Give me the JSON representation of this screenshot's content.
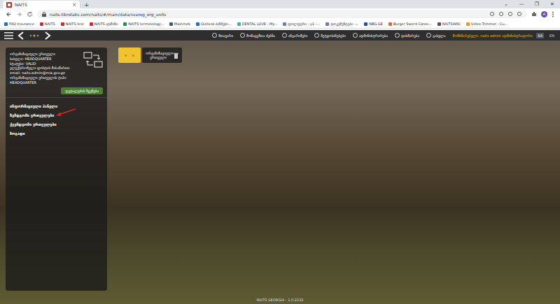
{
  "browser": {
    "tab_title": "NAITS",
    "tab_close": "×",
    "new_tab": "+",
    "window_controls": [
      "⌄",
      "—",
      "❐",
      "✕"
    ],
    "url": "naits.tibrolabs.com/naits/#/main/data/svarog_org_units",
    "profile": "A"
  },
  "bookmarks": [
    {
      "label": "FAO Insurance",
      "color": "#2b6cb0"
    },
    {
      "label": "NAITS",
      "color": "#c53030"
    },
    {
      "label": "NAITS test",
      "color": "#c53030"
    },
    {
      "label": "NAITS ადმინი",
      "color": "#c53030"
    },
    {
      "label": "NAITS terminology...",
      "color": "#2f855a"
    },
    {
      "label": "Mainmeb",
      "color": "#4a5568"
    },
    {
      "label": "Outlook ბიზნესი...",
      "color": "#2b6cb0"
    },
    {
      "label": "DENTAL LOVE - My...",
      "color": "#38b2ac"
    },
    {
      "label": "ფოლდერი - y1 -...",
      "color": "#718096"
    },
    {
      "label": "დოკუმენტები -...",
      "color": "#718096"
    },
    {
      "label": "NBG.GE",
      "color": "#2c5282"
    },
    {
      "label": "Burger Sword Caree...",
      "color": "#dd6b20"
    },
    {
      "label": "NAITSWIKI",
      "color": "#4a5568"
    },
    {
      "label": "Video Trimmer - Cu...",
      "color": "#d69e2e"
    }
  ],
  "app_header": {
    "nav": [
      "მთავარი",
      "მონაცემთა ძებნა",
      "ანგარიშები",
      "შეტყობინებები",
      "ადმინისტრირება",
      "დახმარება",
      "გასვლა"
    ],
    "user": "მომხმარებელი: naits admin ადმინისტრატორი",
    "languages": [
      {
        "label": "KA",
        "selected": true
      },
      {
        "label": "EN",
        "selected": false
      }
    ]
  },
  "sidebar": {
    "info": [
      "ორგანიზაციული ერთეული",
      "სახელი: HEADQUARTER",
      "სტატუსი: VALID",
      "ელექტრონული ფოსტის მისამართი",
      "email: naits.admin@mia.gov.ge",
      "ორგანიზაციული ერთეულის ტიპი: HEADQUARTER"
    ],
    "button": "დეტალების ჩვენება",
    "items": [
      {
        "label": "ინფორმაციული პანელი",
        "pointed": false
      },
      {
        "label": "ზემდგომი ერთეულები",
        "pointed": true
      },
      {
        "label": "ქვემდგომი ერთეულები",
        "pointed": false
      },
      {
        "label": "ზოგადი",
        "pointed": false
      }
    ]
  },
  "toolbar": {
    "stars": [
      "★",
      "★"
    ],
    "tile": "ორგანიზაციული ერთეული"
  },
  "footer": "NAITS GEORGIA - 1.0.2132"
}
